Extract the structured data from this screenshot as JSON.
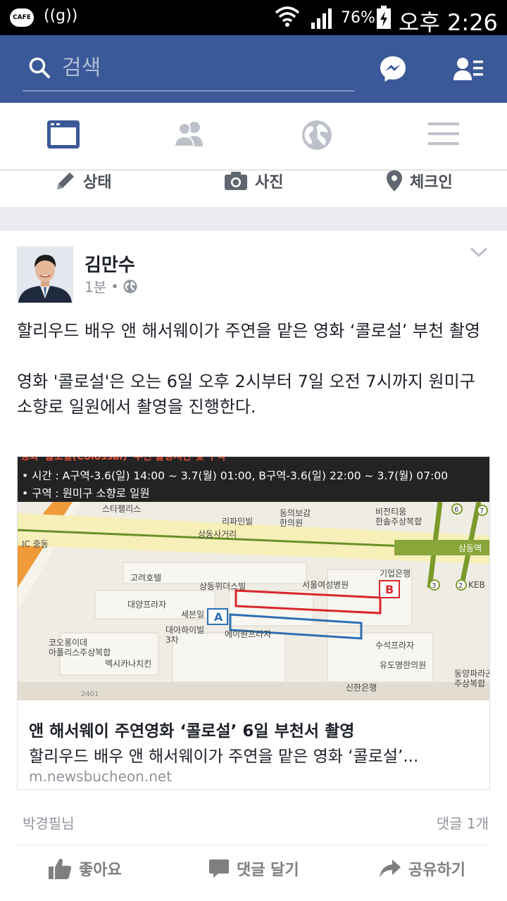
{
  "status_bar": {
    "cafe_label": "CAFE",
    "signal_glyph": "((g))",
    "battery_percent": "76%",
    "time": "오후 2:26",
    "icons": [
      "wifi-icon",
      "cell-signal-icon",
      "battery-charging-icon"
    ]
  },
  "header": {
    "search_placeholder": "검색",
    "brand_color": "#3b5998",
    "icons": [
      "search-icon",
      "messenger-icon",
      "friend-requests-icon"
    ]
  },
  "tabs": [
    {
      "name": "news-feed",
      "icon": "news-feed-icon",
      "active": true
    },
    {
      "name": "friends",
      "icon": "friends-icon",
      "active": false
    },
    {
      "name": "notifications",
      "icon": "globe-icon",
      "active": false
    },
    {
      "name": "menu",
      "icon": "menu-icon",
      "active": false
    }
  ],
  "composer": {
    "status_label": "상태",
    "photo_label": "사진",
    "checkin_label": "체크인"
  },
  "post": {
    "author": "김만수",
    "time": "1분",
    "separator": "•",
    "privacy_icon": "globe-icon",
    "text": "할리우드 배우 앤 해서웨이가 주연을 맡은 영화 ‘콜로설’ 부천 촬영\n\n영화 '콜로설'은 오는 6일 오후 2시부터 7일 오전 7시까지 원미구 소향로 일원에서 촬영을 진행한다.",
    "link": {
      "image": {
        "banner_top": "영화 '콜로설(Colossal)' 부천 촬영시간 및 구역",
        "time_line": "• 시간 : A구역-3.6(일) 14:00 ~ 3.7(월) 01:00, B구역-3.6(일) 22:00 ~ 3.7(월) 07:00",
        "area_line": "• 구역 : 원미구 소향로 일원",
        "map_labels": {
          "starpalace": "스타팰리스",
          "ripain": "리파인빌",
          "dongui": "동의보감\n한의원",
          "bijin": "비전티움\n한솔주상복합",
          "sangdong_sageori": "상동사거리",
          "sangdong_station": "상동역",
          "ic": "IC 중동",
          "goryeo": "고려호텔",
          "sangdong_widus": "상동위더스빌",
          "seoul_women": "서울여성병원",
          "ibk": "기업은행",
          "keb": "KEB",
          "daeyang": "대양프라자",
          "sebeom": "세븐일",
          "daeya": "대아하이빌\n3차",
          "eiwon": "에이원프라자",
          "suseok": "수석프라자",
          "yudong": "유도명한의원",
          "dongyang": "동양파라곤\n주상복합",
          "coolong": "코오롱이데\n아폴리스주상복합",
          "mexicana": "멕시카나치킨",
          "shinhan": "신한은행",
          "road_no": "2401",
          "zone_a": "A",
          "zone_b": "B",
          "line_7_top": "7",
          "line_6_top": "6",
          "line_3": "3",
          "line_2": "2"
        },
        "zone_a_color": "#2c6fb3",
        "zone_b_color": "#d9262b"
      },
      "title": "앤 해서웨이 주연영화 ‘콜로설’ 6일 부천서 촬영",
      "description": "할리우드 배우 앤 해서웨이가 주연을 맡은 영화 ‘콜로설’...",
      "domain": "m.newsbucheon.net"
    },
    "liked_by": "박경필님",
    "comment_count": "댓글 1개",
    "actions": {
      "like": "좋아요",
      "comment": "댓글 달기",
      "share": "공유하기"
    }
  }
}
